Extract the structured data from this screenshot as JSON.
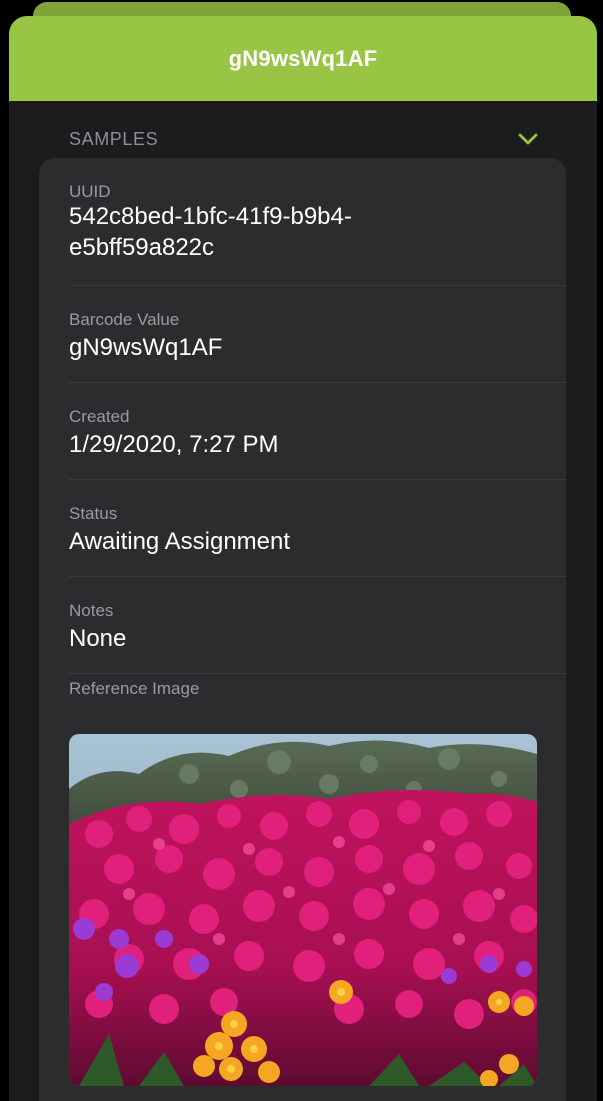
{
  "header": {
    "title": "gN9wsWq1AF"
  },
  "section": {
    "title": "SAMPLES",
    "toggle_icon": "chevron-down-icon",
    "accent": "#98c543"
  },
  "details": {
    "uuid_label": "UUID",
    "uuid_value": "542c8bed-1bfc-41f9-b9b4-e5bff59a822c",
    "barcode_label": "Barcode Value",
    "barcode_value": "gN9wsWq1AF",
    "created_label": "Created",
    "created_value": "1/29/2020, 7:27 PM",
    "status_label": "Status",
    "status_value": "Awaiting Assignment",
    "notes_label": "Notes",
    "notes_value": "None",
    "reference_label": "Reference Image"
  },
  "image": {
    "subject": "magenta ice plant flowers with yellow blooms and green shrubs"
  }
}
